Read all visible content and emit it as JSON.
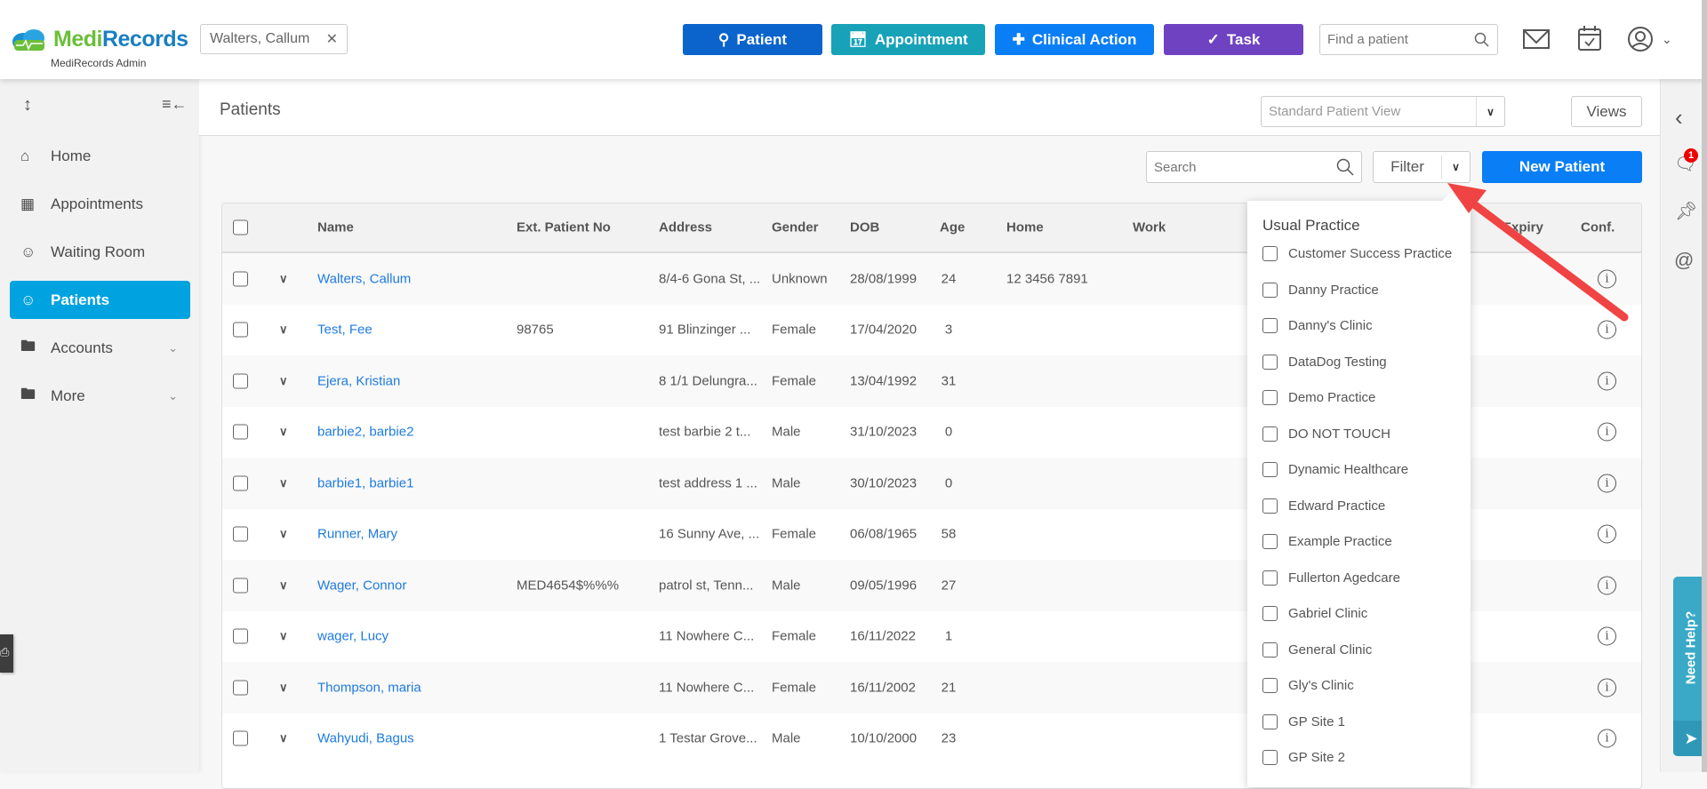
{
  "header": {
    "logo_text_1": "Medi",
    "logo_text_2": "Records",
    "logo_sub": "MediRecords Admin",
    "patient_chip": "Walters, Callum",
    "buttons": [
      {
        "label": "Patient",
        "color": "#0a64cc",
        "icon": "person-add-icon"
      },
      {
        "label": "Appointment",
        "color": "#17a2b8",
        "icon": "calendar-add-icon"
      },
      {
        "label": "Clinical Action",
        "color": "#0a7ef5",
        "icon": "medical-bag-icon"
      },
      {
        "label": "Task",
        "color": "#6f42c1",
        "icon": "clipboard-check-icon"
      }
    ],
    "find_placeholder": "Find a patient"
  },
  "sidebar": {
    "items": [
      {
        "label": "Home",
        "icon": "home-icon"
      },
      {
        "label": "Appointments",
        "icon": "calendar-icon"
      },
      {
        "label": "Waiting Room",
        "icon": "waiting-room-icon"
      },
      {
        "label": "Patients",
        "icon": "users-icon",
        "active": true
      },
      {
        "label": "Accounts",
        "icon": "folder-icon",
        "expandable": true
      },
      {
        "label": "More",
        "icon": "folder-plus-icon",
        "expandable": true
      }
    ]
  },
  "page": {
    "title": "Patients",
    "view_select": "Standard Patient View",
    "views_label": "Views",
    "search_placeholder": "Search",
    "filter_label": "Filter",
    "new_patient_label": "New Patient"
  },
  "table": {
    "columns": [
      "Name",
      "Ext. Patient No",
      "Address",
      "Gender",
      "DOB",
      "Age",
      "Home",
      "Work",
      "Expiry",
      "Conf."
    ],
    "rows": [
      {
        "name": "Walters, Callum",
        "ext": "",
        "address": "8/4-6 Gona St, ...",
        "gender": "Unknown",
        "dob": "28/08/1999",
        "age": "24",
        "home": "12 3456 7891"
      },
      {
        "name": "Test, Fee",
        "ext": "98765",
        "address": "91 Blinzinger ...",
        "gender": "Female",
        "dob": "17/04/2020",
        "age": "3",
        "home": ""
      },
      {
        "name": "Ejera, Kristian",
        "ext": "",
        "address": "8 1/1 Delungra...",
        "gender": "Female",
        "dob": "13/04/1992",
        "age": "31",
        "home": ""
      },
      {
        "name": "barbie2, barbie2",
        "ext": "",
        "address": "test barbie 2 t...",
        "gender": "Male",
        "dob": "31/10/2023",
        "age": "0",
        "home": ""
      },
      {
        "name": "barbie1, barbie1",
        "ext": "",
        "address": "test address 1 ...",
        "gender": "Male",
        "dob": "30/10/2023",
        "age": "0",
        "home": ""
      },
      {
        "name": "Runner, Mary",
        "ext": "",
        "address": "16 Sunny Ave, ...",
        "gender": "Female",
        "dob": "06/08/1965",
        "age": "58",
        "home": ""
      },
      {
        "name": "Wager, Connor",
        "ext": "MED4654$%%%",
        "address": "patrol st, Tenn...",
        "gender": "Male",
        "dob": "09/05/1996",
        "age": "27",
        "home": ""
      },
      {
        "name": "wager, Lucy",
        "ext": "",
        "address": "11 Nowhere C...",
        "gender": "Female",
        "dob": "16/11/2022",
        "age": "1",
        "home": ""
      },
      {
        "name": "Thompson, maria",
        "ext": "",
        "address": "11 Nowhere C...",
        "gender": "Female",
        "dob": "16/11/2002",
        "age": "21",
        "home": ""
      },
      {
        "name": "Wahyudi, Bagus",
        "ext": "",
        "address": "1 Testar Grove...",
        "gender": "Male",
        "dob": "10/10/2000",
        "age": "23",
        "home": ""
      }
    ]
  },
  "filter_dropdown": {
    "title": "Usual Practice",
    "options": [
      "Customer Success Practice",
      "Danny Practice",
      "Danny's Clinic",
      "DataDog Testing",
      "Demo Practice",
      "DO NOT TOUCH",
      "Dynamic Healthcare",
      "Edward Practice",
      "Example Practice",
      "Fullerton Agedcare",
      "Gabriel Clinic",
      "General Clinic",
      "Gly's Clinic",
      "GP Site 1",
      "GP Site 2"
    ]
  },
  "rail": {
    "chat_badge": "1",
    "need_help": "Need Help?"
  },
  "colors": {
    "accent": "#00a3e0",
    "link": "#1e7be0",
    "primary": "#0a7ef5",
    "annotation_arrow": "#f04444"
  }
}
